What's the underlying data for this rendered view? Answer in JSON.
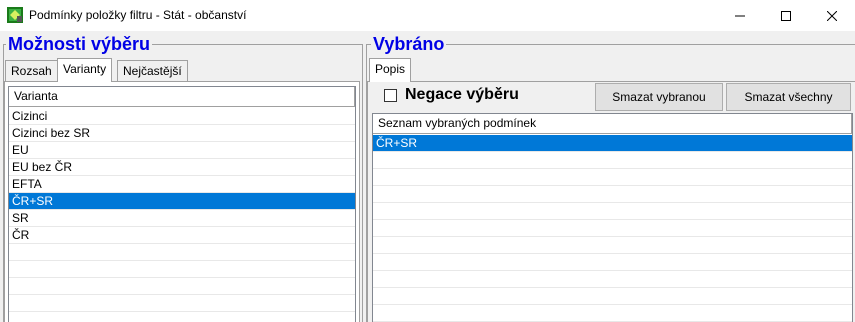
{
  "window": {
    "title": "Podmínky položky filtru - Stát - občanství",
    "minimize_glyph": "─",
    "maximize_glyph": "☐",
    "close_glyph": "✕"
  },
  "left": {
    "title": "Možnosti výběru",
    "tabs": [
      "Rozsah",
      "Varianty",
      "Nejčastější"
    ],
    "active_tab": "Varianty",
    "list": {
      "header": "Varianta",
      "items": [
        "Cizinci",
        "Cizinci bez SR",
        "EU",
        "EU bez ČR",
        "EFTA",
        "ČR+SR",
        "SR",
        "ČR"
      ],
      "selected": "ČR+SR"
    }
  },
  "right": {
    "title": "Vybráno",
    "tabs": [
      "Popis"
    ],
    "negace_label": "Negace výběru",
    "negace_checked": false,
    "buttons": {
      "clear_selected": "Smazat vybranou",
      "clear_all": "Smazat všechny"
    },
    "list": {
      "header": "Seznam vybraných podmínek",
      "items": [
        "ČR+SR"
      ],
      "selected": "ČR+SR"
    }
  },
  "colors": {
    "title_accent": "#0000e6",
    "selection": "#0078d7"
  }
}
